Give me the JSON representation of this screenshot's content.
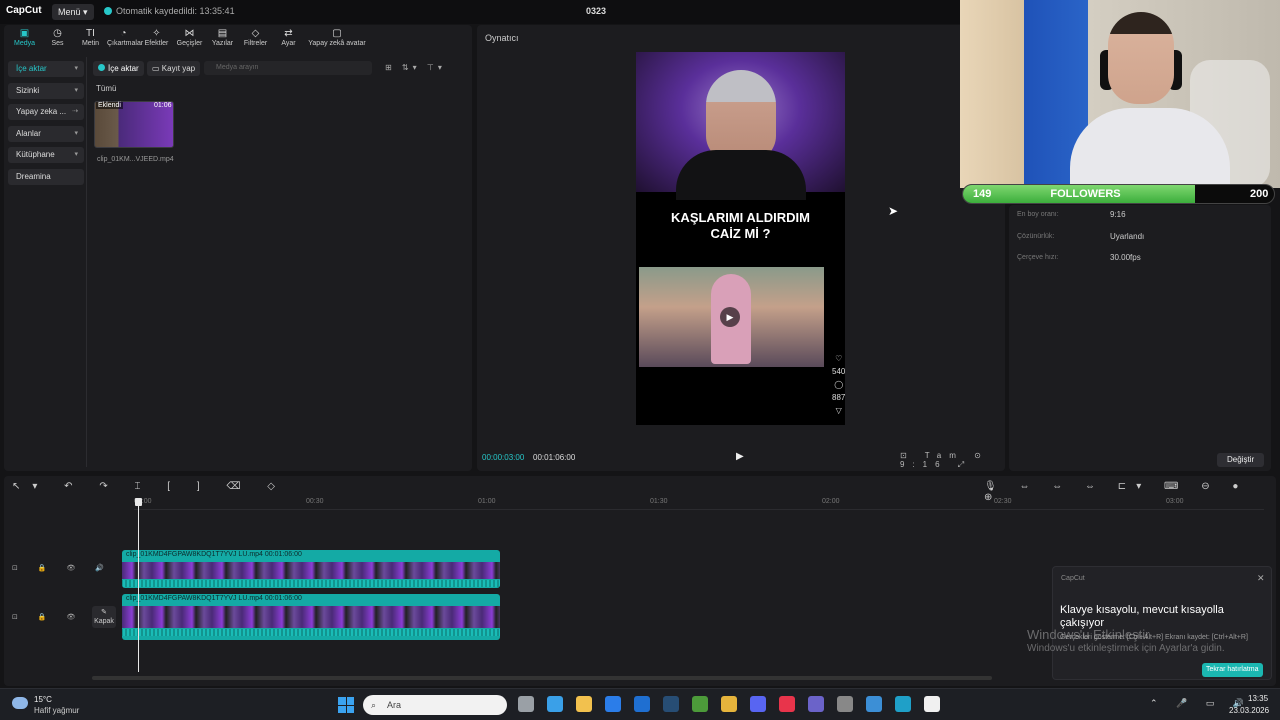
{
  "app": {
    "logo": "CapCut",
    "menu_label": "Menü",
    "autosave": "Otomatik kaydedildi: 13:35:41",
    "project_title": "0323"
  },
  "toolbar": [
    {
      "label": "Medya",
      "icon": "media-icon",
      "glyph": "▣"
    },
    {
      "label": "Ses",
      "icon": "audio-icon",
      "glyph": "◷"
    },
    {
      "label": "Metin",
      "icon": "text-icon",
      "glyph": "TI"
    },
    {
      "label": "Çıkartmalar",
      "icon": "sticker-icon",
      "glyph": "◔"
    },
    {
      "label": "Efektler",
      "icon": "effects-icon",
      "glyph": "✧"
    },
    {
      "label": "Geçişler",
      "icon": "transitions-icon",
      "glyph": "⋈"
    },
    {
      "label": "Yazılar",
      "icon": "captions-icon",
      "glyph": "▤"
    },
    {
      "label": "Filtreler",
      "icon": "filters-icon",
      "glyph": "◇"
    },
    {
      "label": "Ayar",
      "icon": "adjust-icon",
      "glyph": "⇄"
    },
    {
      "label": "Yapay zekâ avatar",
      "icon": "ai-avatar-icon",
      "glyph": "▢"
    }
  ],
  "sidebar": {
    "items": [
      {
        "label": "İçe aktar",
        "chev": "▾"
      },
      {
        "label": "Sizinki",
        "chev": "▾"
      },
      {
        "label": "Yapay zeka ...",
        "chev": "⇢"
      },
      {
        "label": "Alanlar",
        "chev": "▾"
      },
      {
        "label": "Kütüphane",
        "chev": "▾"
      },
      {
        "label": "Dreamina",
        "chev": ""
      }
    ]
  },
  "media": {
    "import_button": "İçe aktar",
    "record_button": "Kayıt yap",
    "search_placeholder": "Medya arayın",
    "filter_icons": "⊞ ⇅▾ ⊤▾",
    "all_label": "Tümü",
    "clip": {
      "badge": "Eklendi",
      "duration": "01:06",
      "name": "clip_01KM...VJEED.mp4"
    }
  },
  "player": {
    "title": "Oynatıcı",
    "caption_line1": "KAŞLARIMI ALDIRDIM",
    "caption_line2": "CAİZ Mİ ?",
    "play_glyph": "▶",
    "side_icons": [
      "♡",
      "540",
      "◯",
      "887",
      "▽"
    ],
    "current_time": "00:00:03:00",
    "total_time": "00:01:06:00",
    "tools": "⊡ Tam ⊙ 9:16 ⤢"
  },
  "details": {
    "rows": [
      {
        "key": "En boy oranı:",
        "value": "9:16"
      },
      {
        "key": "Çözünürlük:",
        "value": "Uyarlandı"
      },
      {
        "key": "Çerçeve hızı:",
        "value": "30.00fps"
      }
    ],
    "change_button": "Değiştir"
  },
  "followers": {
    "current": 149,
    "goal": 200,
    "label": "FOLLOWERS",
    "progress": 0.745
  },
  "timeline": {
    "tools_left": "↖▾ ↶ ↷ ⌶ [ ] ⌫ ◇",
    "tools_right": "🎙 ⇔ ⇔ ⇔ ⊏▾ ⌨ ⊖ ● ⊕",
    "ticks": [
      "00:00",
      "00:30",
      "01:00",
      "01:30",
      "02:00",
      "02:30",
      "03:00"
    ],
    "clip_video": "clip_01KMD4FGPAW8KDQ1T7YVJ LU.mp4   00:01:06:00",
    "clip_main": "clip_01KMD4FGPAW8KDQ1T7YVJ LU.mp4   00:01:06:00",
    "track_controls": "⊡ 🔒 👁 🔊 ⋯",
    "cover_label": "Kapak",
    "cover_glyph": "✎"
  },
  "notification": {
    "app": "CapCut",
    "close": "✕",
    "title": "Klavye kısayolu, mevcut kısayolla çakışıyor",
    "subtitle": "Gerçekleri gösterme: [Ctrl+Alt+R] Ekranı kaydet: [Ctrl+Alt+R]",
    "button": "Tekrar hatırlatma"
  },
  "watermark": {
    "line1": "Windows'u Etkinleştir",
    "line2": "Windows'u etkinleştirmek için Ayarlar'a gidin."
  },
  "taskbar": {
    "weather_temp": "15°C",
    "weather_desc": "Hafif yağmur",
    "search_placeholder": "Ara",
    "apps": [
      {
        "name": "taskview-icon",
        "color": "#9aa0a6"
      },
      {
        "name": "desktop-icon",
        "color": "#3aa0e8"
      },
      {
        "name": "explorer-icon",
        "color": "#f2c14e"
      },
      {
        "name": "store-icon",
        "color": "#2b7de9"
      },
      {
        "name": "outlook-icon",
        "color": "#1f6fd1"
      },
      {
        "name": "steam-icon",
        "color": "#274d74"
      },
      {
        "name": "minecraft-icon",
        "color": "#4c9a3a"
      },
      {
        "name": "chrome-icon",
        "color": "#e6b43c"
      },
      {
        "name": "discord-icon",
        "color": "#5865f2"
      },
      {
        "name": "media-player-icon",
        "color": "#e8344b"
      },
      {
        "name": "teams-icon",
        "color": "#6b63c9"
      },
      {
        "name": "app-icon",
        "color": "#888888"
      },
      {
        "name": "vpn-icon",
        "color": "#3c8fd6"
      },
      {
        "name": "edge-icon",
        "color": "#1fa0c8"
      },
      {
        "name": "capcut-icon",
        "color": "#f0f0f0"
      }
    ],
    "tray": "⌃ 🎤 ▭ 🔊",
    "time": "13:35",
    "date": "23.03.2026"
  }
}
